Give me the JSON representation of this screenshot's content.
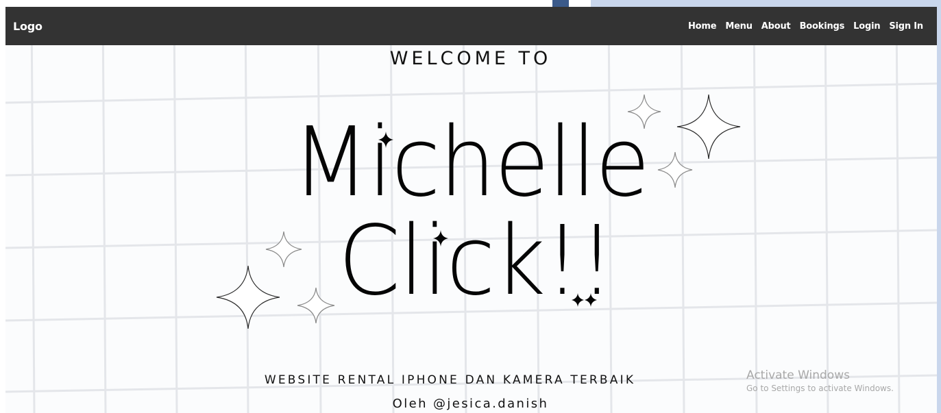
{
  "navbar": {
    "logo": "Logo",
    "links": [
      "Home",
      "Menu",
      "About",
      "Bookings",
      "Login",
      "Sign In"
    ]
  },
  "hero": {
    "welcome": "WELCOME TO",
    "title_line_1": "Michelle",
    "title_line_2": "Click!!",
    "tagline": "WEBSITE RENTAL IPHONE DAN KAMERA TERBAIK",
    "author": "Oleh @jesica.danish"
  },
  "watermark": {
    "title": "Activate Windows",
    "subtitle": "Go to Settings to activate Windows."
  },
  "icons": {
    "sparkle": "sparkle-star-icon"
  },
  "colors": {
    "navbar_bg": "#333333",
    "nav_text": "#ffffff",
    "hero_bg": "#fbfcfd",
    "grid_line": "#e6e8ec",
    "text": "#111111"
  }
}
